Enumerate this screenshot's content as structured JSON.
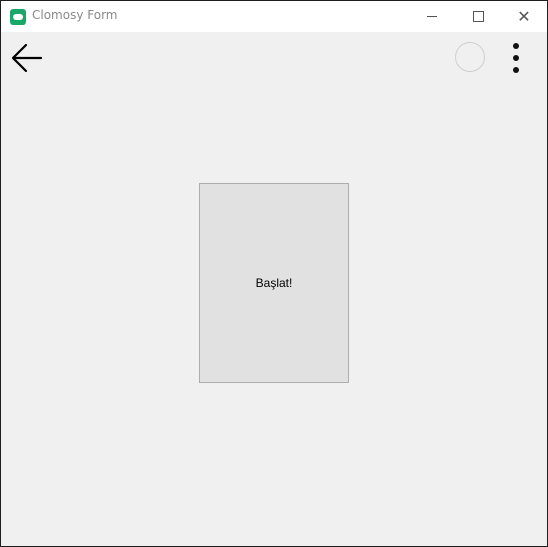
{
  "window": {
    "title": "Clomosy Form",
    "controls": {
      "minimize_icon": "minimize-icon",
      "maximize_icon": "maximize-icon",
      "close_icon": "close-icon",
      "close_glyph": "✕"
    }
  },
  "toolbar": {
    "back_icon": "arrow-left-icon",
    "status_icon": "circle-icon",
    "menu_icon": "more-vertical-icon"
  },
  "main": {
    "start_button_label": "Başlat!"
  },
  "colors": {
    "app_icon": "#1aa86a",
    "background": "#f0f0f0",
    "button_face": "#e1e1e1",
    "button_border": "#adadad"
  }
}
